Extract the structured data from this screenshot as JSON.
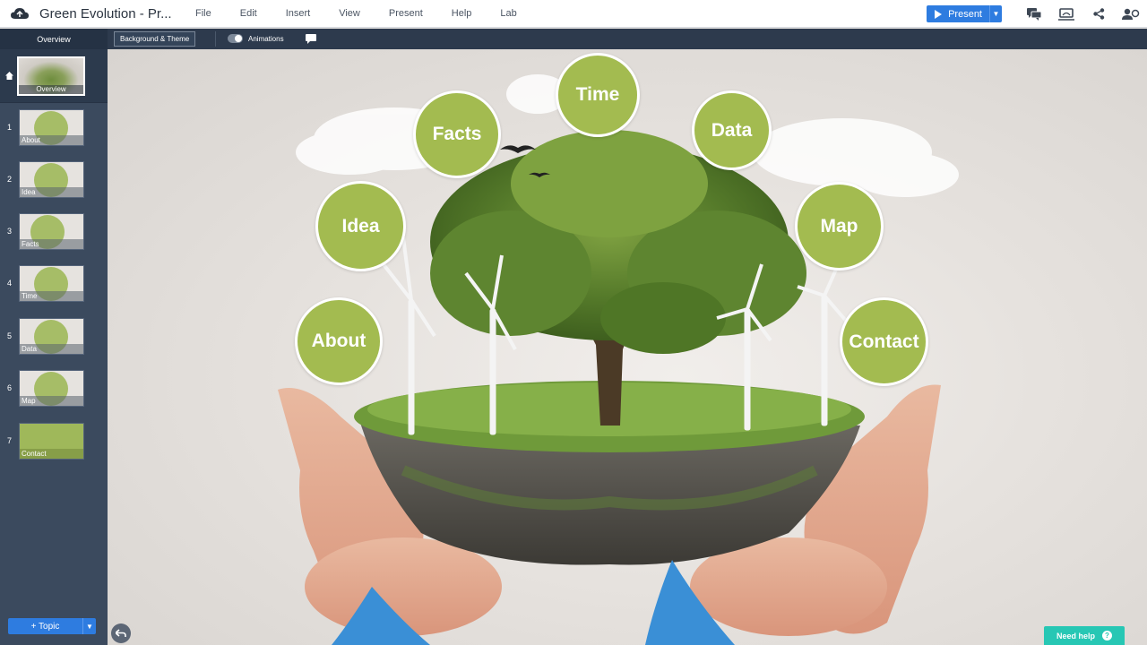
{
  "app": {
    "doc_title": "Green Evolution - Pr...",
    "menu": [
      "File",
      "Edit",
      "Insert",
      "View",
      "Present",
      "Help",
      "Lab"
    ],
    "present_label": "Present"
  },
  "toolbar": {
    "overview_tab": "Overview",
    "background_theme": "Background & Theme",
    "animations": "Animations"
  },
  "sidebar": {
    "overview_label": "Overview",
    "slides": [
      {
        "num": "1",
        "label": "About"
      },
      {
        "num": "2",
        "label": "Idea"
      },
      {
        "num": "3",
        "label": "Facts"
      },
      {
        "num": "4",
        "label": "Time"
      },
      {
        "num": "5",
        "label": "Data"
      },
      {
        "num": "6",
        "label": "Map"
      },
      {
        "num": "7",
        "label": "Contact"
      }
    ],
    "topic_button": "+ Topic"
  },
  "canvas": {
    "bubbles": {
      "time": "Time",
      "facts": "Facts",
      "data": "Data",
      "idea": "Idea",
      "map": "Map",
      "about": "About",
      "contact": "Contact"
    },
    "bubble_color": "#a3bb50"
  },
  "help": {
    "label": "Need help",
    "q": "?"
  },
  "colors": {
    "accent": "#2e7ce0",
    "sidebar": "#3b4a5e",
    "help": "#27c7b4"
  }
}
